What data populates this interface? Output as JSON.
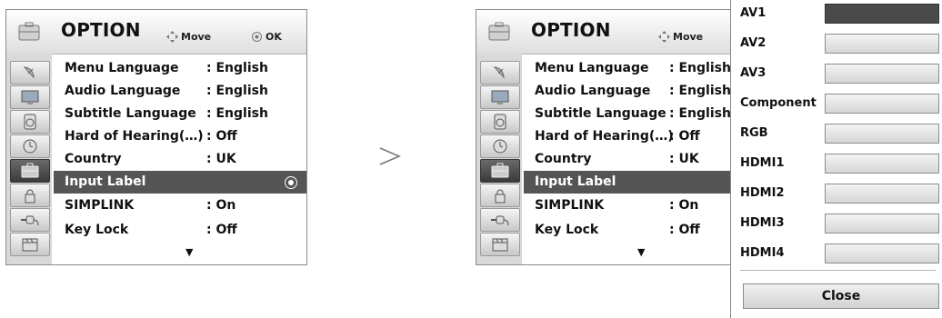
{
  "left_panel": {
    "title": "OPTION",
    "hint_move": "Move",
    "hint_ok": "OK",
    "rows": [
      {
        "label": "Menu Language",
        "value": ": English"
      },
      {
        "label": "Audio Language",
        "value": ": English"
      },
      {
        "label": "Subtitle Language",
        "value": ": English"
      },
      {
        "label": "Hard of Hearing(…)",
        "value": ": Off"
      },
      {
        "label": "Country",
        "value": ": UK"
      },
      {
        "label": "Input Label",
        "value": ""
      },
      {
        "label": "SIMPLINK",
        "value": ": On"
      },
      {
        "label": "Key Lock",
        "value": ": Off"
      }
    ],
    "selected_row": "Input Label",
    "active_side_icon": "option-icon"
  },
  "right_panel": {
    "title": "OPTION",
    "hint_move": "Move",
    "rows": [
      {
        "label": "Menu Language",
        "value": ": English"
      },
      {
        "label": "Audio Language",
        "value": ": English"
      },
      {
        "label": "Subtitle Language",
        "value": ": English"
      },
      {
        "label": "Hard of Hearing(…)",
        "value": ": Off"
      },
      {
        "label": "Country",
        "value": ": UK"
      },
      {
        "label": "Input Label",
        "value": ""
      },
      {
        "label": "SIMPLINK",
        "value": ": On"
      },
      {
        "label": "Key Lock",
        "value": ": Off"
      }
    ]
  },
  "popup": {
    "items": [
      "AV1",
      "AV2",
      "AV3",
      "Component",
      "RGB",
      "HDMI1",
      "HDMI2",
      "HDMI3",
      "HDMI4"
    ],
    "active_item": "AV1",
    "close_label": "Close"
  },
  "side_icons": [
    "satellite-dish-icon",
    "tv-screen-icon",
    "speaker-icon",
    "clock-icon",
    "option-icon",
    "lock-icon",
    "input-plug-icon",
    "usb-film-icon"
  ],
  "colors": {
    "selected_row": "#555555",
    "active_box": "#4a4a4a"
  }
}
